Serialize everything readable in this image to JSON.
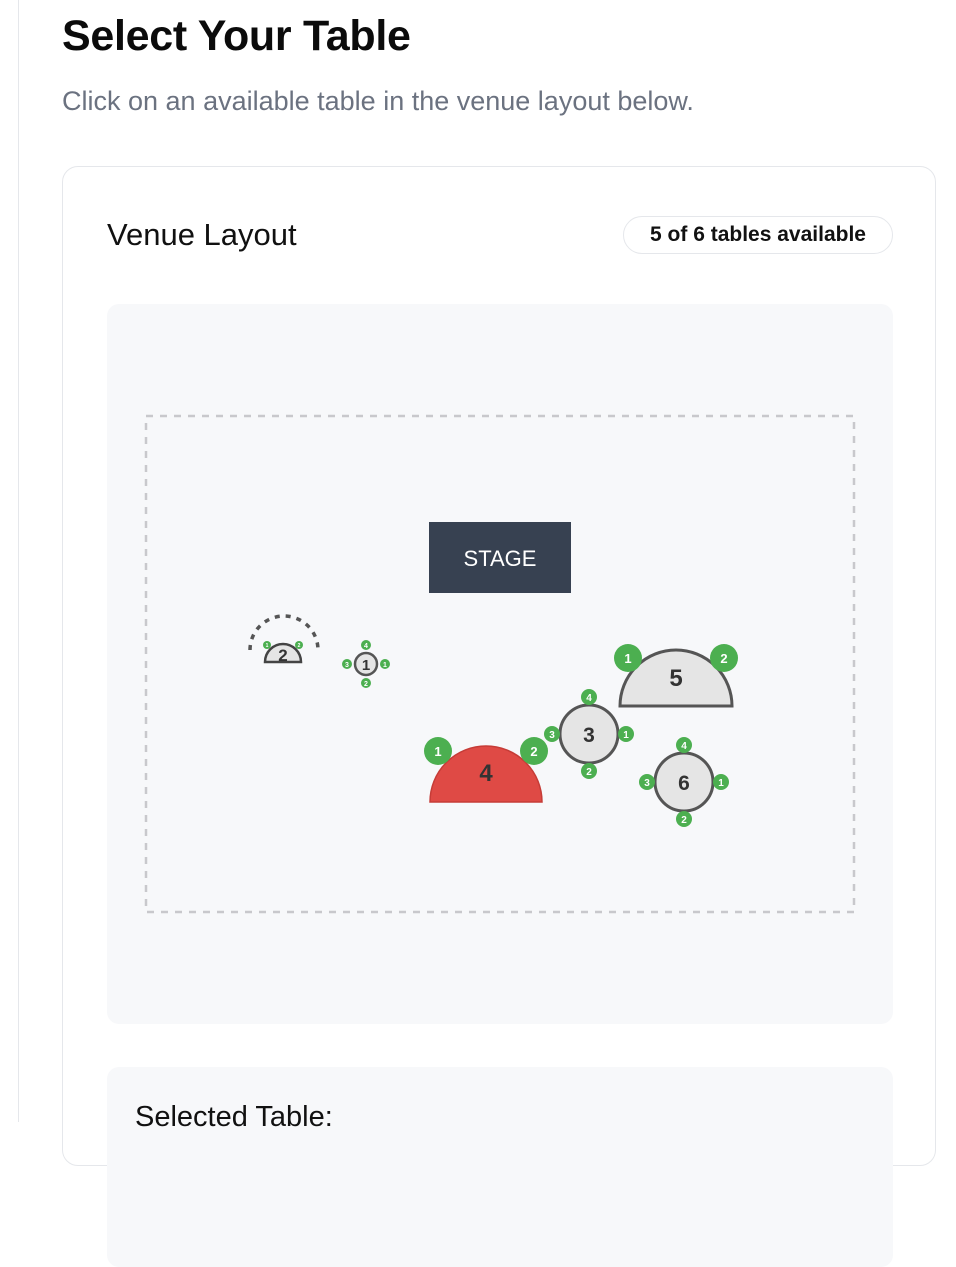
{
  "header": {
    "title": "Select Your Table",
    "subtitle": "Click on an available table in the venue layout below."
  },
  "venue": {
    "title": "Venue Layout",
    "availability": "5 of 6 tables available",
    "stage_label": "STAGE",
    "tables": [
      {
        "number": "1",
        "shape": "round",
        "status": "available",
        "seats": [
          "4",
          "3",
          "1",
          "2"
        ]
      },
      {
        "number": "2",
        "shape": "half-round",
        "status": "available",
        "seats": [
          "1",
          "2"
        ]
      },
      {
        "number": "3",
        "shape": "round",
        "status": "available",
        "seats": [
          "4",
          "3",
          "1",
          "2"
        ]
      },
      {
        "number": "4",
        "shape": "half-round",
        "status": "booked",
        "seats": [
          "1",
          "2"
        ]
      },
      {
        "number": "5",
        "shape": "half-round",
        "status": "available",
        "seats": [
          "1",
          "2"
        ]
      },
      {
        "number": "6",
        "shape": "round",
        "status": "available",
        "seats": [
          "4",
          "3",
          "1",
          "2"
        ]
      }
    ]
  },
  "selected": {
    "label": "Selected Table:"
  },
  "colors": {
    "available_table": "#e5e5e5",
    "booked_table": "#df4a45",
    "seat": "#4caf50",
    "stage": "#374151"
  }
}
